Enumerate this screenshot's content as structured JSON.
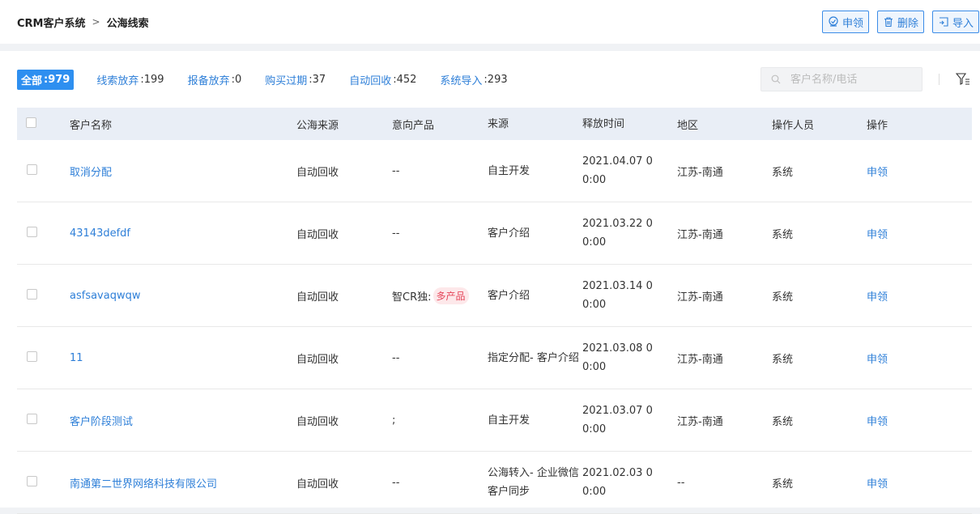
{
  "breadcrumb": {
    "root": "CRM客户系统",
    "separator": ">",
    "current": "公海线索"
  },
  "actions": {
    "claim": "申领",
    "delete": "删除",
    "import": "导入"
  },
  "filters": [
    {
      "label": "全部",
      "count": ":979",
      "active": true
    },
    {
      "label": "线索放弃",
      "count": ":199"
    },
    {
      "label": "报备放弃",
      "count": ":0"
    },
    {
      "label": "购买过期",
      "count": ":37"
    },
    {
      "label": "自动回收",
      "count": ":452"
    },
    {
      "label": "系统导入",
      "count": ":293"
    }
  ],
  "search": {
    "placeholder": "客户名称/电话"
  },
  "columns": [
    "客户名称",
    "公海来源",
    "意向产品",
    "来源",
    "释放时间",
    "地区",
    "操作人员",
    "操作"
  ],
  "rows": [
    {
      "name": "取消分配",
      "source": "自动回收",
      "product": "--",
      "from": "自主开发",
      "time": "2021.04.07 00:00",
      "area": "江苏-南通",
      "operator": "系统",
      "action": "申领"
    },
    {
      "name": "43143defdf",
      "source": "自动回收",
      "product": "--",
      "from": "客户介绍",
      "time": "2021.03.22 00:00",
      "area": "江苏-南通",
      "operator": "系统",
      "action": "申领"
    },
    {
      "name": "asfsavaqwqw",
      "source": "自动回收",
      "product": "智CR独:",
      "product_badge": "多产品",
      "from": "客户介绍",
      "time": "2021.03.14 00:00",
      "area": "江苏-南通",
      "operator": "系统",
      "action": "申领"
    },
    {
      "name": "11",
      "source": "自动回收",
      "product": "--",
      "from": "指定分配- 客户介绍",
      "time": "2021.03.08 00:00",
      "area": "江苏-南通",
      "operator": "系统",
      "action": "申领"
    },
    {
      "name": "客户阶段测试",
      "source": "自动回收",
      "product": ";",
      "from": "自主开发",
      "time": "2021.03.07 00:00",
      "area": "江苏-南通",
      "operator": "系统",
      "action": "申领"
    },
    {
      "name": "南通第二世界网络科技有限公司",
      "source": "自动回收",
      "product": "--",
      "from": "公海转入- 企业微信客户同步",
      "time": "2021.02.03 00:00",
      "area": "--",
      "operator": "系统",
      "action": "申领"
    }
  ],
  "colors": {
    "accent": "#2e7fd8",
    "header_bg": "#e9eef6",
    "badge": "#e5475b"
  }
}
